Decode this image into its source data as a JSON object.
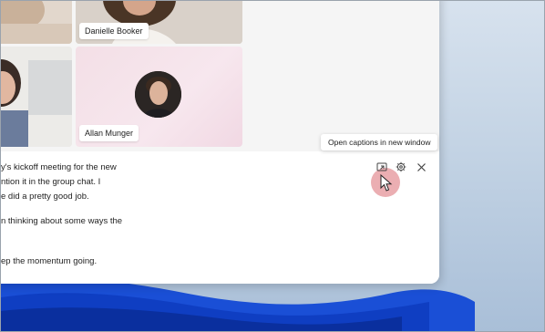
{
  "participants": {
    "tile1_name": "Danielle Booker",
    "tile2_name": "Allan Munger"
  },
  "captions_panel": {
    "tooltip": "Open captions in new window",
    "lines": [
      "y's kickoff meeting for the new",
      "ntion it in the group chat. I",
      "e did a pretty good job.",
      "n thinking about some ways the",
      "ep the momentum going."
    ],
    "icons": {
      "popout": "open-in-new-window-icon",
      "settings": "gear-icon",
      "close": "close-icon"
    }
  }
}
